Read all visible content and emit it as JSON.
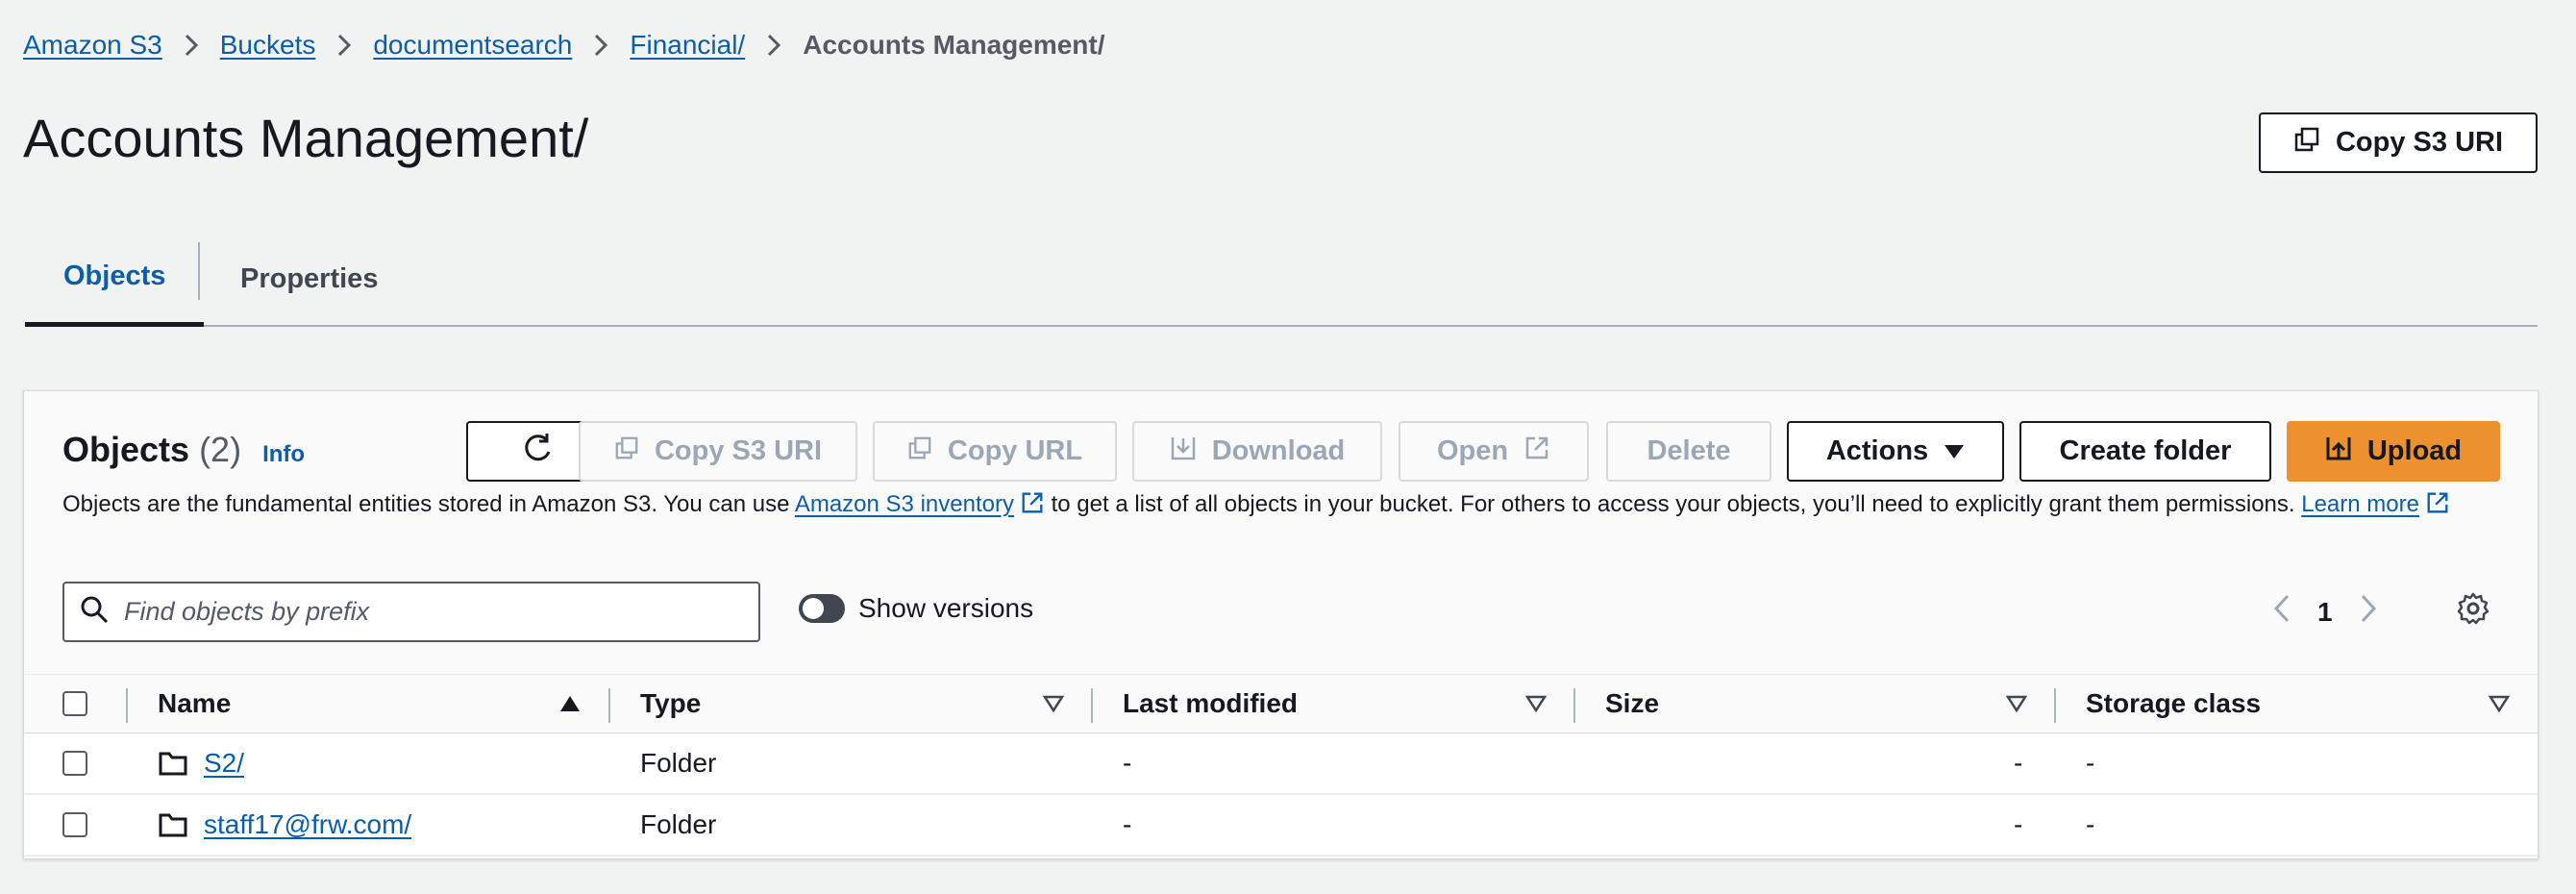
{
  "breadcrumb": {
    "items": [
      "Amazon S3",
      "Buckets",
      "documentsearch",
      "Financial/"
    ],
    "current": "Accounts Management/"
  },
  "page": {
    "title": "Accounts Management/",
    "copy_uri_label": "Copy S3 URI"
  },
  "tabs": [
    {
      "label": "Objects",
      "active": true
    },
    {
      "label": "Properties",
      "active": false
    }
  ],
  "objects_panel": {
    "title": "Objects",
    "count": "(2)",
    "info_label": "Info",
    "description_part1": "Objects are the fundamental entities stored in Amazon S3. You can use ",
    "inventory_link": "Amazon S3 inventory",
    "description_part2": " to get a list of all objects in your bucket. For others to access your objects, you’ll need to explicitly grant them permissions. ",
    "learn_more_link": "Learn more",
    "toolbar": {
      "copy_s3_uri": "Copy S3 URI",
      "copy_url": "Copy URL",
      "download": "Download",
      "open": "Open",
      "delete": "Delete",
      "actions": "Actions",
      "create_folder": "Create folder",
      "upload": "Upload"
    },
    "search": {
      "placeholder": "Find objects by prefix",
      "value": ""
    },
    "show_versions_label": "Show versions",
    "show_versions_on": false,
    "pagination": {
      "current_page": "1"
    },
    "table": {
      "columns": [
        "Name",
        "Type",
        "Last modified",
        "Size",
        "Storage class"
      ],
      "rows": [
        {
          "name": "S2/",
          "type": "Folder",
          "last_modified": "-",
          "size": "-",
          "storage_class": "-"
        },
        {
          "name": "staff17@frw.com/",
          "type": "Folder",
          "last_modified": "-",
          "size": "-",
          "storage_class": "-"
        }
      ]
    }
  },
  "colors": {
    "link": "#0c5ea9",
    "primary": "#ec912d",
    "text": "#16191f",
    "background": "#f1f2f2"
  }
}
